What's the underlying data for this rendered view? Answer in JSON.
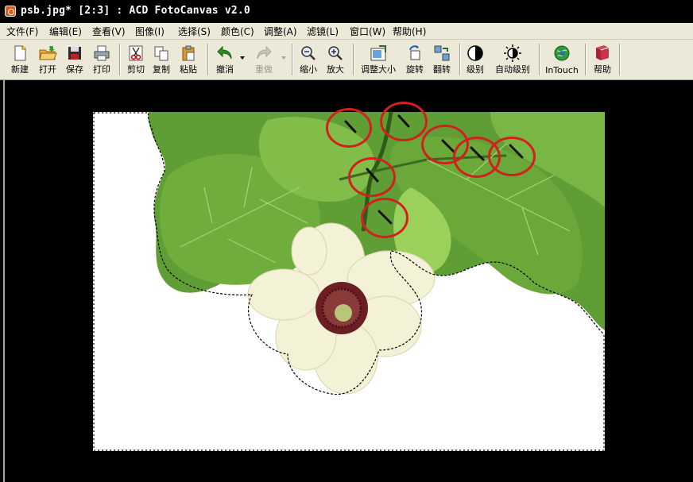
{
  "window": {
    "title": "psb.jpg* [2:3]  : ACD FotoCanvas v2.0"
  },
  "menu": [
    {
      "label": "文件(F)"
    },
    {
      "label": "编辑(E)"
    },
    {
      "label": "查看(V)"
    },
    {
      "label": "图像(I)"
    },
    {
      "label": "选择(S)"
    },
    {
      "label": "颜色(C)"
    },
    {
      "label": "调整(A)"
    },
    {
      "label": "滤镜(L)"
    },
    {
      "label": "窗口(W)"
    },
    {
      "label": "帮助(H)"
    }
  ],
  "toolbar": {
    "new": "新建",
    "open": "打开",
    "save": "保存",
    "print": "打印",
    "cut": "剪切",
    "copy": "复制",
    "paste": "粘贴",
    "undo": "撤消",
    "redo": "重做",
    "zoom_out": "缩小",
    "zoom_in": "放大",
    "resize": "调整大小",
    "rotate": "旋转",
    "flip": "翻转",
    "levels": "级别",
    "auto_levels": "自动级别",
    "intouch": "InTouch",
    "help": "帮助"
  },
  "colors": {
    "annotation": "#d41f1f",
    "leaf": "#6aa83a",
    "flower_center": "#6b1f24",
    "toolbar_bg": "#ece9d8"
  },
  "icons": [
    "magic-wand-icon"
  ]
}
